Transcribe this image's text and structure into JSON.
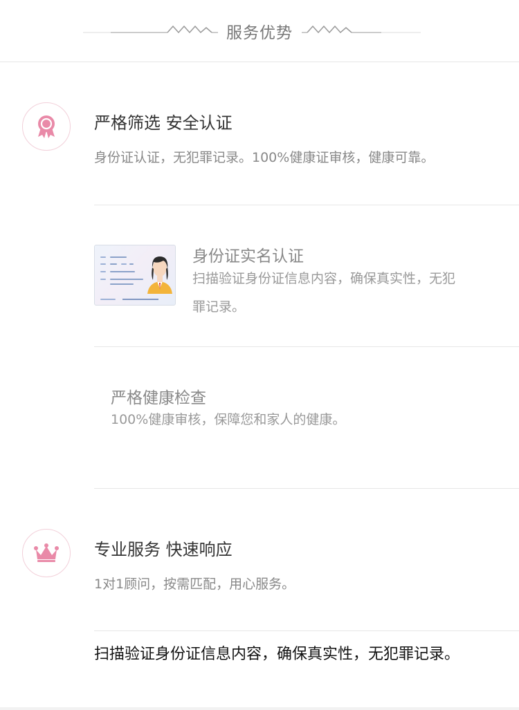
{
  "header": {
    "title": "服务优势"
  },
  "sections": [
    {
      "title": "严格筛选 安全认证",
      "desc": "身份证认证，无犯罪记录。100%健康证审核，健康可靠。",
      "icon": "ribbon-award-icon"
    },
    {
      "title": "专业服务 快速响应",
      "desc": "1对1顾问，按需匹配，用心服务。",
      "icon": "crown-icon"
    }
  ],
  "sub_items": [
    {
      "title": "身份证实名认证",
      "desc_line1": "扫描验证身份证信息内容，确保真实性，无犯",
      "desc_line2": "罪记录。",
      "image": "id-card-image"
    },
    {
      "title": "严格健康检查",
      "desc": "100%健康审核，保障您和家人的健康。"
    }
  ],
  "bottom_text": "扫描验证身份证信息内容，确保真实性，无犯罪记录。",
  "colors": {
    "accent_pink": "#e98aa8",
    "circle_border": "#f2cfd9",
    "divider": "#e6e6e6"
  }
}
